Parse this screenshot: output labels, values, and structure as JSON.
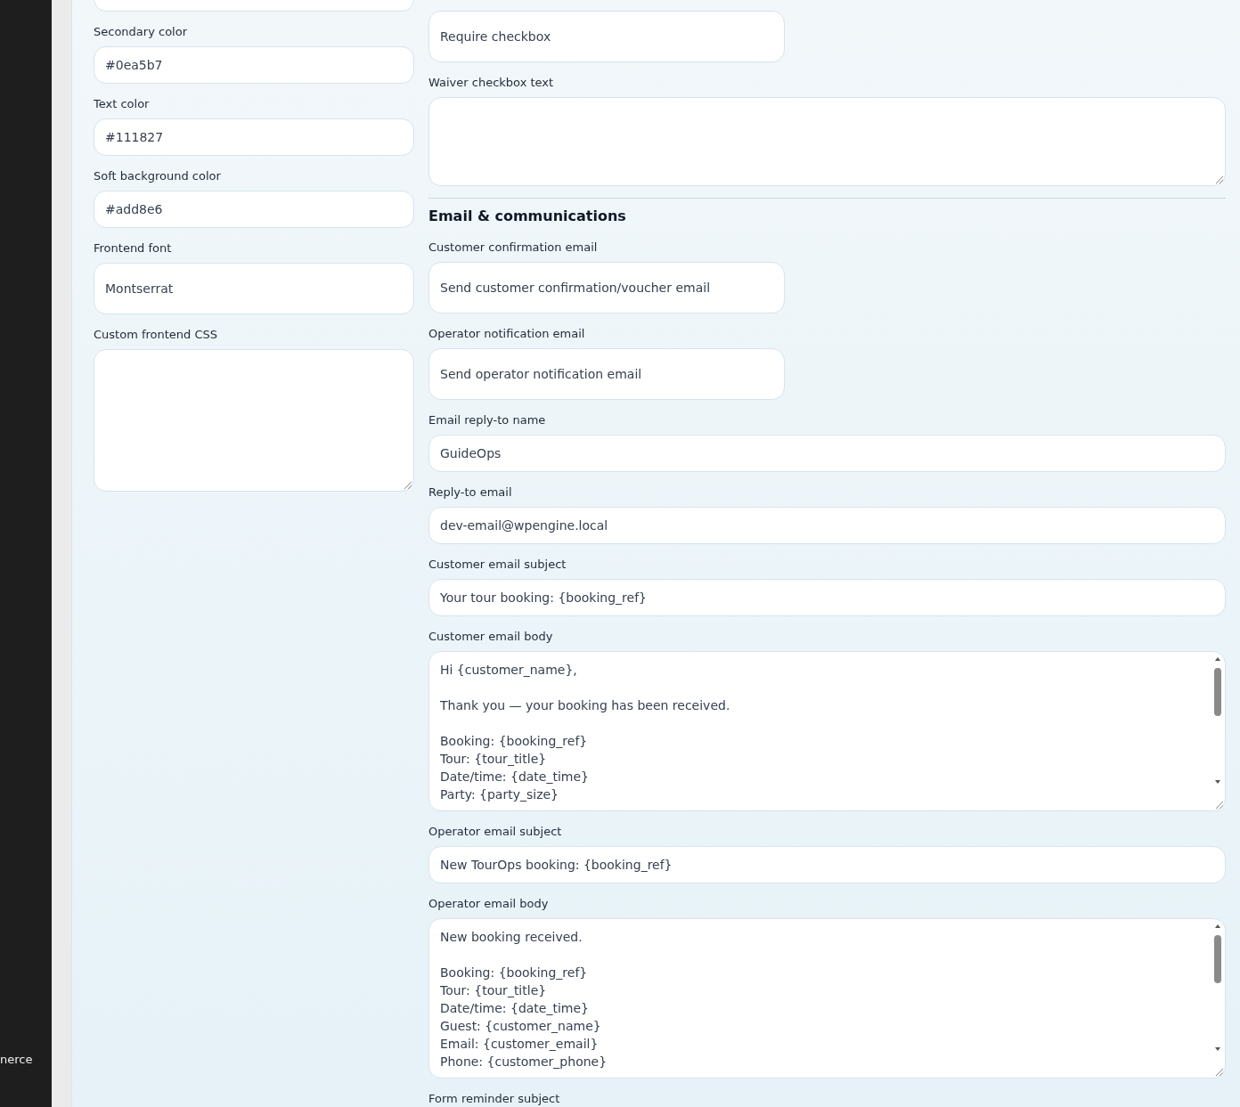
{
  "sidebar": {
    "items": [
      {
        "label": "nerce"
      }
    ]
  },
  "left_fields": [
    {
      "kind": "input"
    },
    {
      "kind": "input",
      "label": "Secondary color",
      "value": "#0ea5b7"
    },
    {
      "kind": "input",
      "label": "Text color",
      "value": "#111827"
    },
    {
      "kind": "input",
      "label": "Soft background color",
      "value": "#add8e6"
    },
    {
      "kind": "select",
      "label": "Frontend font",
      "value": "Montserrat"
    },
    {
      "kind": "textarea",
      "label": "Custom frontend CSS"
    }
  ],
  "right_items": [
    {
      "kind": "select",
      "value": "Require checkbox"
    },
    {
      "kind": "textarea",
      "label": "Waiver checkbox text"
    },
    {
      "kind": "heading",
      "label": "Email & communications"
    },
    {
      "kind": "select",
      "label": "Customer confirmation email",
      "value": "Send customer confirmation/voucher email"
    },
    {
      "kind": "select",
      "label": "Operator notification email",
      "value": "Send operator notification email"
    },
    {
      "kind": "input",
      "label": "Email reply-to name",
      "value": "GuideOps"
    },
    {
      "kind": "input",
      "label": "Reply-to email",
      "value": "dev-email@wpengine.local"
    },
    {
      "kind": "input",
      "label": "Customer email subject",
      "value": "Your tour booking: {booking_ref}"
    },
    {
      "kind": "textarea",
      "label": "Customer email body",
      "value": "Hi {customer_name},\n\nThank you — your booking has been received.\n\nBooking: {booking_ref}\nTour: {tour_title}\nDate/time: {date_time}\nParty: {party_size}"
    },
    {
      "kind": "input",
      "label": "Operator email subject",
      "value": "New TourOps booking: {booking_ref}"
    },
    {
      "kind": "textarea",
      "label": "Operator email body",
      "value": "New booking received.\n\nBooking: {booking_ref}\nTour: {tour_title}\nDate/time: {date_time}\nGuest: {customer_name}\nEmail: {customer_email}\nPhone: {customer_phone}"
    },
    {
      "kind": "label",
      "label": "Form reminder subject"
    }
  ]
}
